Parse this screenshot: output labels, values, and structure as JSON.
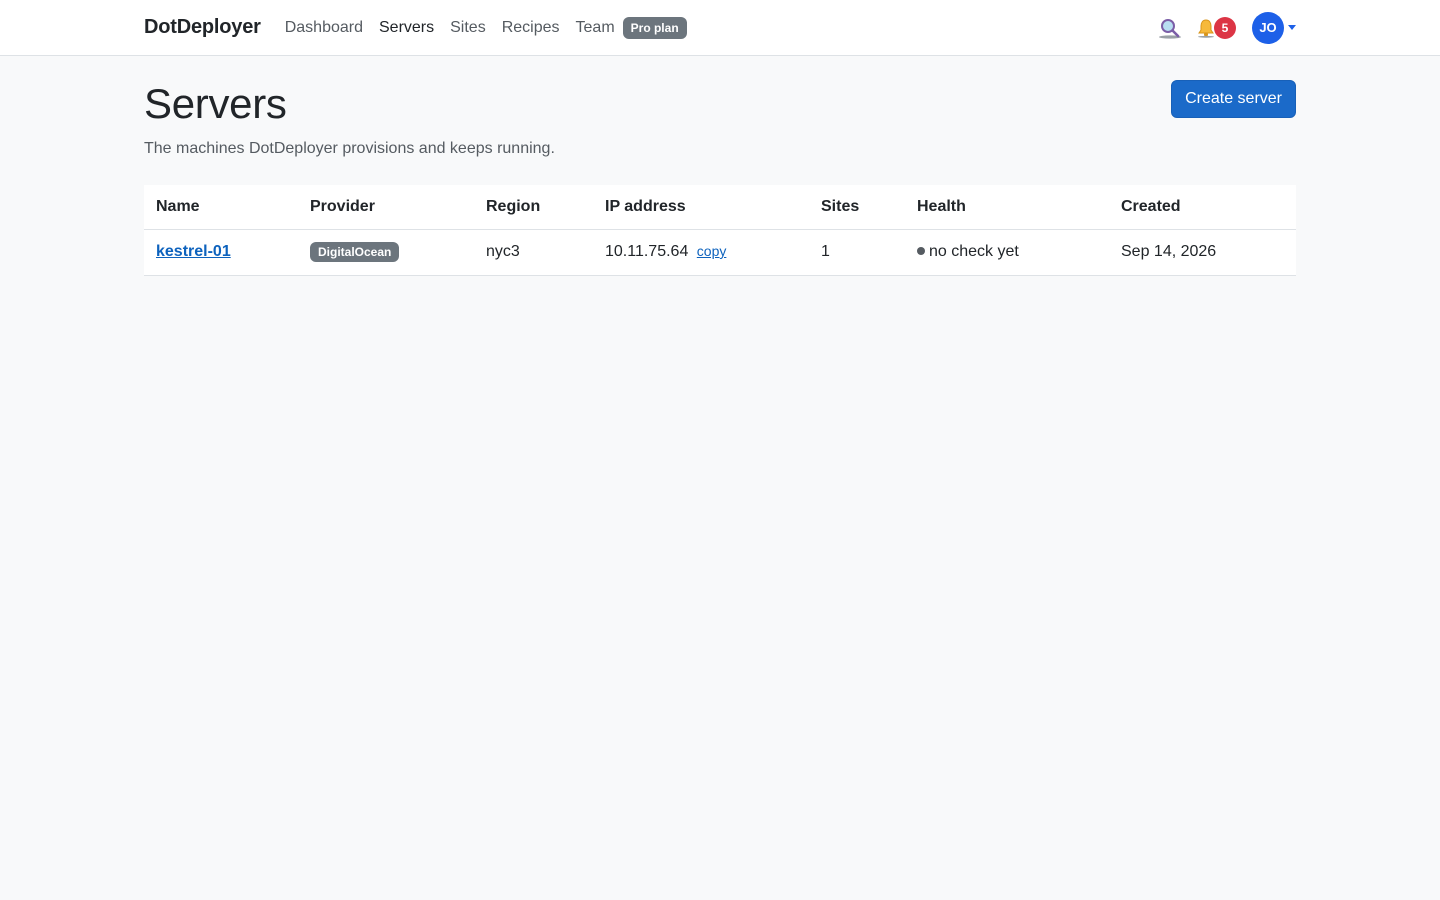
{
  "nav": {
    "brand": "DotDeployer",
    "links": [
      "Dashboard",
      "Servers",
      "Sites",
      "Recipes",
      "Team"
    ],
    "plan_badge": "Pro plan",
    "notification_count": "5",
    "avatar_initials": "JO"
  },
  "page": {
    "title": "Servers",
    "subtitle": "The machines DotDeployer provisions and keeps running.",
    "create_button": "Create server"
  },
  "table": {
    "headers": [
      "Name",
      "Provider",
      "Region",
      "IP address",
      "Sites",
      "Health",
      "Created"
    ],
    "rows": [
      {
        "name": "kestrel-01",
        "provider": "DigitalOcean",
        "region": "nyc3",
        "ip": "10.11.75.64",
        "copy_label": "copy",
        "sites": "1",
        "health": "no check yet",
        "created": "Sep 14, 2026"
      }
    ]
  },
  "icons": {
    "search": "search-icon",
    "bell": "bell-icon",
    "caret": "chevron-down-icon"
  },
  "colors": {
    "primary": "#1b6ac9",
    "link": "#0d62bd",
    "badge_gray": "#6c757d",
    "danger": "#dc3545",
    "avatar": "#1d60e8"
  }
}
